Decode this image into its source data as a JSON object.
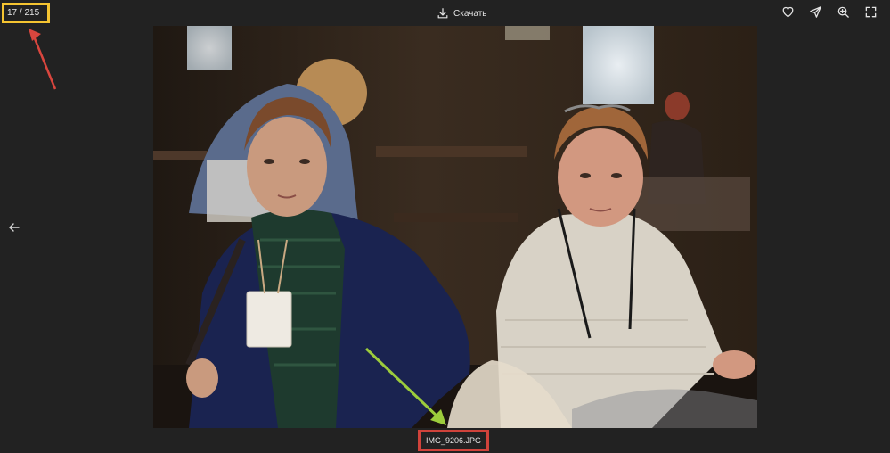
{
  "viewer": {
    "counter": "17 / 215",
    "download_label": "Скачать",
    "filename": "IMG_9206.JPG"
  },
  "icons": {
    "download": "download-icon",
    "favorite": "heart-icon",
    "share": "send-icon",
    "zoom": "zoom-in-icon",
    "fullscreen": "fullscreen-icon",
    "previous": "arrow-left-icon"
  },
  "colors": {
    "background": "#222222",
    "counter_highlight": "#f5c431",
    "filename_highlight": "#d0433b",
    "annotation_red_arrow": "#d9463e",
    "annotation_green_arrow": "#9ccc3c"
  }
}
